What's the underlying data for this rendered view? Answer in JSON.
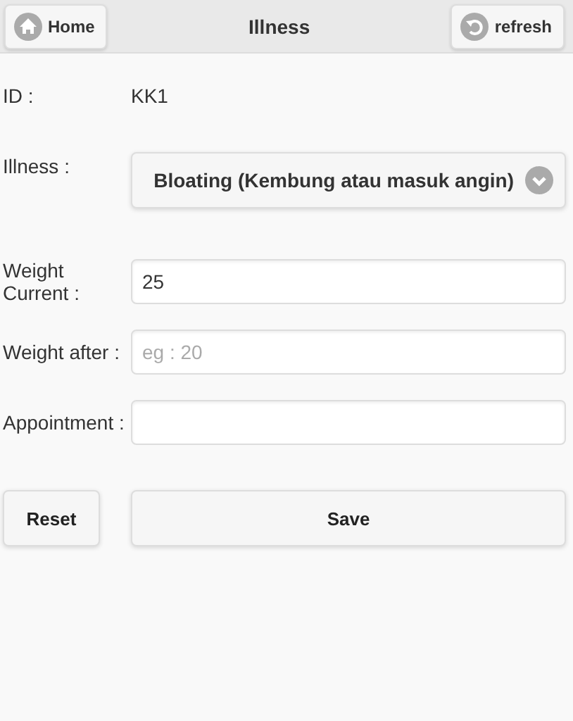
{
  "header": {
    "title": "Illness",
    "left_button": {
      "label": "Home"
    },
    "right_button": {
      "label": "refresh"
    }
  },
  "id_row": {
    "label": "ID :",
    "value": "KK1"
  },
  "fields": [
    {
      "kind": "select",
      "label": "Illness :",
      "value": "Bloating (Kembung atau masuk angin)"
    },
    {
      "kind": "input",
      "label": "Weight Current :",
      "value": "25"
    },
    {
      "kind": "input",
      "label": "Weight after :",
      "placeholder": "eg : 20"
    },
    {
      "kind": "input",
      "label": "Appointment :"
    }
  ],
  "buttons": [
    {
      "label": "Reset"
    },
    {
      "label": "Save"
    }
  ]
}
